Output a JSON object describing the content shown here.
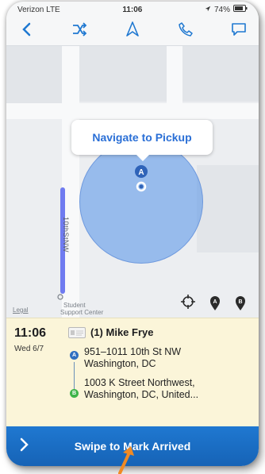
{
  "status_bar": {
    "carrier": "Verizon LTE",
    "time": "11:06",
    "battery": "74%"
  },
  "toolbar": {
    "icons": [
      "back-chevron-icon",
      "crossed-arrows-icon",
      "navigation-arrow-icon",
      "phone-icon",
      "chat-bubble-icon"
    ]
  },
  "map": {
    "callout_text": "Navigate to Pickup",
    "pin_letter": "A",
    "street_label": "10thStNW",
    "legal_label": "Legal",
    "poi_label_line1": "Student",
    "poi_label_line2": "Support Center",
    "marker_a": "A",
    "marker_b": "B"
  },
  "trip": {
    "time": "11:06",
    "date": "Wed 6/7",
    "passenger": "(1) Mike Frye",
    "pickup_line1": "951–1011 10th St NW",
    "pickup_line2": "Washington, DC",
    "dropoff_line1": "1003 K Street Northwest,",
    "dropoff_line2": "Washington, DC, United..."
  },
  "action": {
    "swipe_label": "Swipe to Mark Arrived"
  },
  "colors": {
    "accent": "#1f78d1",
    "pickup_dot": "#2f6fc0",
    "dropoff_dot": "#3fb44a",
    "panel": "#fbf5d9",
    "annotation_arrow": "#f08a24"
  }
}
